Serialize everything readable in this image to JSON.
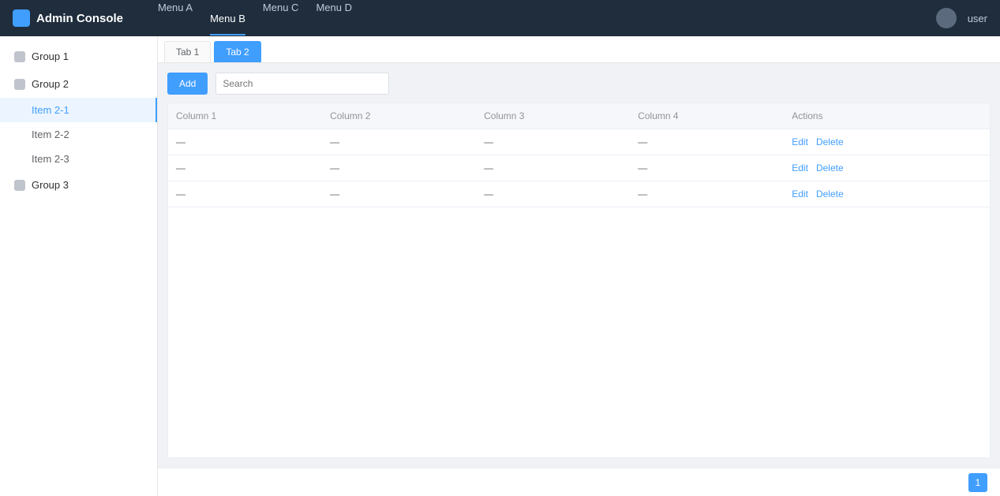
{
  "app": {
    "title": "Admin Console"
  },
  "topnav": [
    {
      "label": "Menu A",
      "active": false
    },
    {
      "label": "Menu B",
      "active": true
    },
    {
      "label": "Menu C",
      "active": false
    },
    {
      "label": "Menu D",
      "active": false
    }
  ],
  "user": {
    "name": "user"
  },
  "sidebar": {
    "groups": [
      {
        "label": "Group 1",
        "items": []
      },
      {
        "label": "Group 2",
        "items": [
          "Item 2-1",
          "Item 2-2",
          "Item 2-3"
        ]
      },
      {
        "label": "Group 3",
        "items": []
      }
    ]
  },
  "tabs": [
    {
      "label": "Tab 1",
      "active": false
    },
    {
      "label": "Tab 2",
      "active": true
    }
  ],
  "toolbar": {
    "add_label": "Add",
    "search_placeholder": "Search"
  },
  "table": {
    "columns": [
      "Column 1",
      "Column 2",
      "Column 3",
      "Column 4",
      "Actions"
    ],
    "rows": [
      [
        "—",
        "—",
        "—",
        "—"
      ],
      [
        "—",
        "—",
        "—",
        "—"
      ],
      [
        "—",
        "—",
        "—",
        "—"
      ]
    ],
    "actions": [
      "Edit",
      "Delete"
    ]
  },
  "pagination": {
    "pages": [
      "1"
    ],
    "current": "1"
  }
}
